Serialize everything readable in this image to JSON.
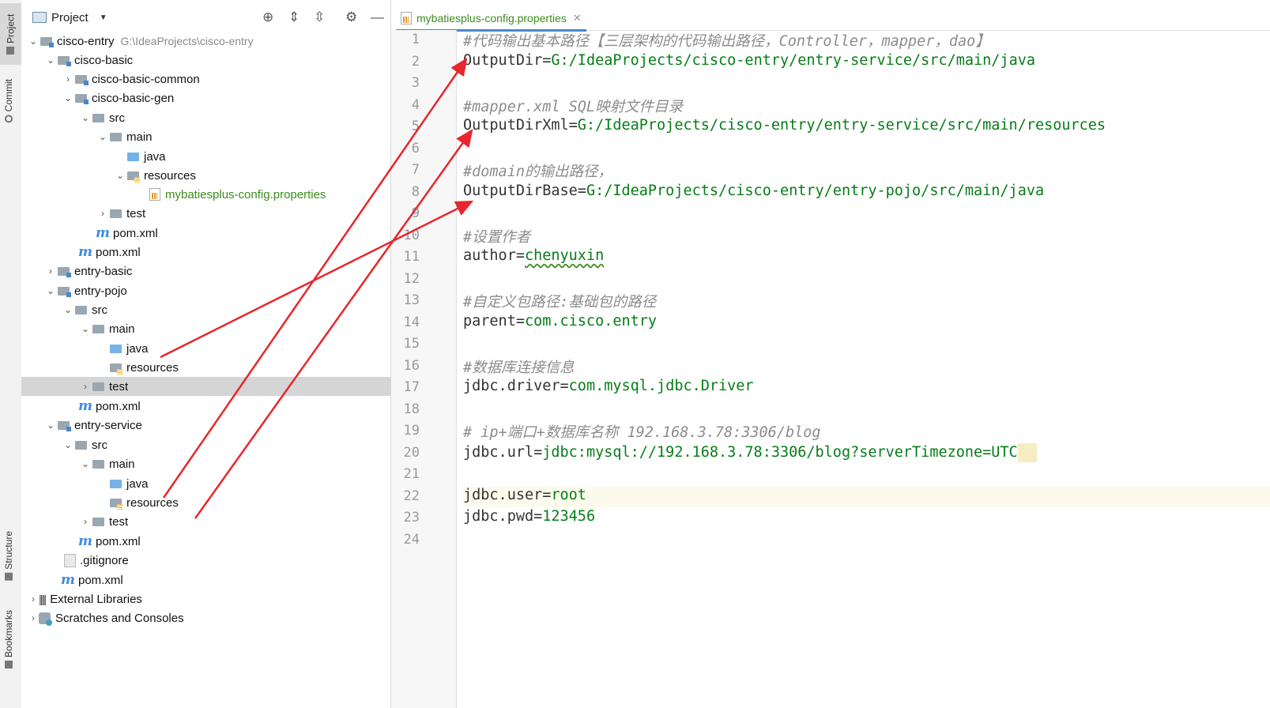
{
  "side_tabs": {
    "project": "Project",
    "commit": "Commit",
    "structure": "Structure",
    "bookmarks": "Bookmarks"
  },
  "panel": {
    "title": "Project"
  },
  "tree": [
    {
      "label": "cisco-entry",
      "path": "G:\\IdeaProjects\\cisco-entry"
    },
    {
      "label": "cisco-basic"
    },
    {
      "label": "cisco-basic-common"
    },
    {
      "label": "cisco-basic-gen"
    },
    {
      "label": "src"
    },
    {
      "label": "main"
    },
    {
      "label": "java"
    },
    {
      "label": "resources"
    },
    {
      "label": "mybatiesplus-config.properties"
    },
    {
      "label": "test"
    },
    {
      "label": "pom.xml"
    },
    {
      "label": "pom.xml"
    },
    {
      "label": "entry-basic"
    },
    {
      "label": "entry-pojo"
    },
    {
      "label": "src"
    },
    {
      "label": "main"
    },
    {
      "label": "java"
    },
    {
      "label": "resources"
    },
    {
      "label": "test"
    },
    {
      "label": "pom.xml"
    },
    {
      "label": "entry-service"
    },
    {
      "label": "src"
    },
    {
      "label": "main"
    },
    {
      "label": "java"
    },
    {
      "label": "resources"
    },
    {
      "label": "test"
    },
    {
      "label": "pom.xml"
    },
    {
      "label": ".gitignore"
    },
    {
      "label": "pom.xml"
    },
    {
      "label": "External Libraries"
    },
    {
      "label": "Scratches and Consoles"
    }
  ],
  "editor": {
    "tab": "mybatiesplus-config.properties",
    "line_numbers": [
      "1",
      "2",
      "3",
      "4",
      "5",
      "6",
      "7",
      "8",
      "9",
      "10",
      "11",
      "12",
      "13",
      "14",
      "15",
      "16",
      "17",
      "18",
      "19",
      "20",
      "21",
      "22",
      "23",
      "24"
    ],
    "lines": [
      {
        "comment": "#代码输出基本路径【三层架构的代码输出路径，Controller，mapper，dao】"
      },
      {
        "key": "OutputDir",
        "value": "G:/IdeaProjects/cisco-entry/entry-service/src/main/java"
      },
      {},
      {
        "comment": "#mapper.xml SQL映射文件目录"
      },
      {
        "key": "OutputDirXml",
        "value": "G:/IdeaProjects/cisco-entry/entry-service/src/main/resources"
      },
      {},
      {
        "comment": "#domain的输出路径，"
      },
      {
        "key": "OutputDirBase",
        "value": "G:/IdeaProjects/cisco-entry/entry-pojo/src/main/java"
      },
      {},
      {
        "comment": "#设置作者"
      },
      {
        "key": "author",
        "value": "chenyuxin"
      },
      {},
      {
        "comment": "#自定义包路径:基础包的路径"
      },
      {
        "key": "parent",
        "value": "com.cisco.entry"
      },
      {},
      {
        "comment": "#数据库连接信息"
      },
      {
        "key": "jdbc.driver",
        "value": "com.mysql.jdbc.Driver"
      },
      {},
      {
        "comment": "# ip+端口+数据库名称 192.168.3.78:3306/blog"
      },
      {
        "key": "jdbc.url",
        "value": "jdbc:mysql://192.168.3.78:3306/blog?serverTimezone=UTC"
      },
      {},
      {
        "key": "jdbc.user",
        "value": "root"
      },
      {
        "key": "jdbc.pwd",
        "value": "123456"
      },
      {}
    ]
  },
  "colors": {
    "annotation_arrow": "#e8262d",
    "value": "#067d17",
    "comment": "#8c8c8c"
  }
}
